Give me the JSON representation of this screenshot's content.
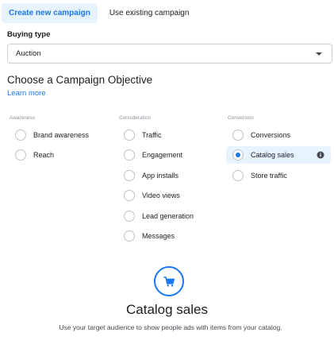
{
  "tabs": [
    {
      "label": "Create new campaign",
      "active": true
    },
    {
      "label": "Use existing campaign",
      "active": false
    }
  ],
  "buying_type": {
    "label": "Buying type",
    "value": "Auction"
  },
  "objective": {
    "heading": "Choose a Campaign Objective",
    "learn_more": "Learn more"
  },
  "columns": [
    {
      "header": "Awareness",
      "options": [
        {
          "label": "Brand awareness",
          "selected": false
        },
        {
          "label": "Reach",
          "selected": false
        }
      ]
    },
    {
      "header": "Consideration",
      "options": [
        {
          "label": "Traffic",
          "selected": false
        },
        {
          "label": "Engagement",
          "selected": false
        },
        {
          "label": "App installs",
          "selected": false
        },
        {
          "label": "Video views",
          "selected": false
        },
        {
          "label": "Lead generation",
          "selected": false
        },
        {
          "label": "Messages",
          "selected": false
        }
      ]
    },
    {
      "header": "Conversion",
      "options": [
        {
          "label": "Conversions",
          "selected": false
        },
        {
          "label": "Catalog sales",
          "selected": true
        },
        {
          "label": "Store traffic",
          "selected": false
        }
      ]
    }
  ],
  "selected_objective": {
    "icon": "shopping-cart-icon",
    "title": "Catalog sales",
    "description": "Use your target audience to show people ads with items from your catalog."
  },
  "colors": {
    "accent": "#1877f2",
    "active_bg": "#e7f3ff",
    "muted_text": "#8d949e"
  }
}
